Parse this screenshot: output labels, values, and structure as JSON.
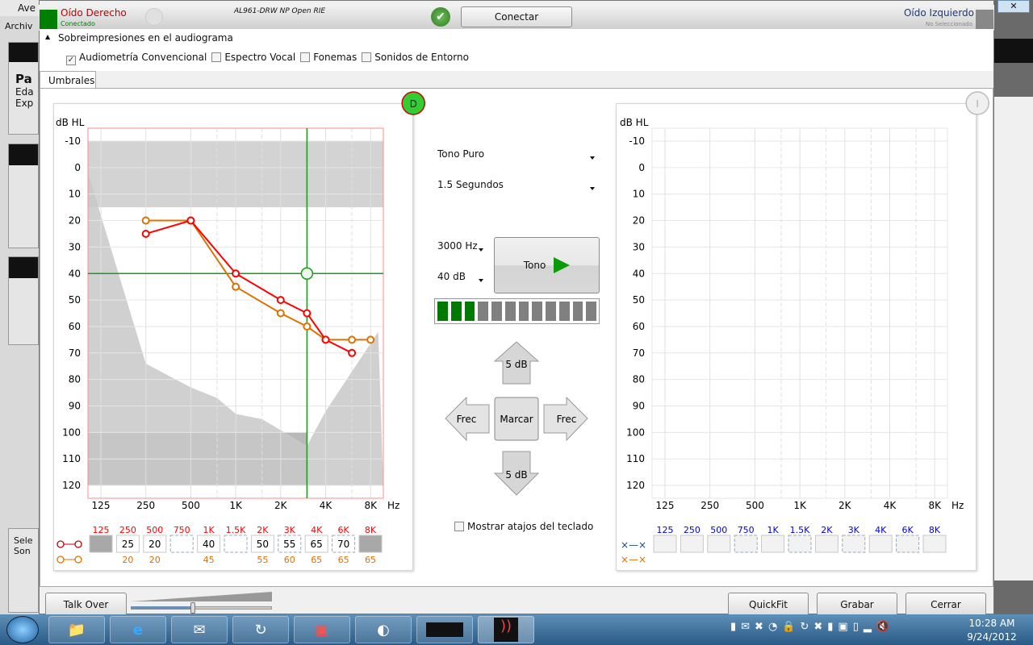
{
  "background_app": {
    "title_fragment": "Ave",
    "menu_fragment": "Archiv",
    "panel_fragment": "Pa",
    "lines": [
      "Eda",
      "Exp"
    ],
    "bottom_fragments": [
      "Sele",
      "Son"
    ]
  },
  "header": {
    "right_ear": {
      "title": "Oído Derecho",
      "status": "Conectado",
      "color": "#008000"
    },
    "device_name": "AL961-DRW NP Open RIE",
    "connect_button": "Conectar",
    "left_ear": {
      "title": "Oído Izquierdo",
      "status": "No Seleccionado"
    }
  },
  "overlays": {
    "title": "Sobreimpresiones en el audiograma",
    "options": [
      {
        "label": "Audiometría Convencional",
        "checked": true
      },
      {
        "label": "Espectro Vocal",
        "checked": false
      },
      {
        "label": "Fonemas",
        "checked": false
      },
      {
        "label": "Sonidos de Entorno",
        "checked": false
      }
    ]
  },
  "tabs": [
    {
      "label": "Umbrales",
      "active": true
    }
  ],
  "controls": {
    "stimulus": "Tono Puro",
    "duration": "1.5 Segundos",
    "frequency": "3000 Hz",
    "level": "40 dB",
    "tone_button": "Tono",
    "level_meter": {
      "lit": 3,
      "total": 12
    },
    "up_button": "5 dB",
    "down_button": "5 dB",
    "left_button": "Frec",
    "right_button": "Frec",
    "mark_button": "Marcar",
    "shortcuts_label": "Mostrar atajos del teclado",
    "shortcuts_checked": false
  },
  "footer": {
    "talk_over": "Talk Over",
    "talk_over_volume": 0.4,
    "quickfit": "QuickFit",
    "save": "Grabar",
    "close": "Cerrar"
  },
  "taskbar": {
    "time": "10:28 AM",
    "date": "9/24/2012"
  },
  "chart_data": [
    {
      "type": "line",
      "ear_badge": "D",
      "ylabel": "dB HL",
      "xlabel": "Hz",
      "ylim": [
        -10,
        120
      ],
      "y_ticks": [
        "-10",
        "0",
        "10",
        "20",
        "30",
        "40",
        "50",
        "60",
        "70",
        "80",
        "90",
        "100",
        "110",
        "120"
      ],
      "x_ticks": [
        "125",
        "250",
        "500",
        "1K",
        "2K",
        "4K",
        "8K"
      ],
      "x_scale": "log",
      "cursor": {
        "frequency_hz": 3000,
        "level_db": 40
      },
      "shading": {
        "normal_band_db": [
          -10,
          15
        ],
        "bottom_band_db": [
          100,
          120
        ],
        "bottom_band_hz": [
          125,
          3000
        ],
        "lower_region": [
          [
            100,
            2
          ],
          [
            250,
            74
          ],
          [
            500,
            83
          ],
          [
            750,
            87
          ],
          [
            1000,
            93
          ],
          [
            1500,
            95
          ],
          [
            3000,
            105
          ],
          [
            4000,
            92
          ],
          [
            9000,
            62
          ]
        ]
      },
      "series": [
        {
          "color": "#ff0000",
          "points": [
            [
              250,
              25
            ],
            [
              500,
              20
            ],
            [
              1000,
              40
            ],
            [
              2000,
              50
            ],
            [
              3000,
              55
            ],
            [
              4000,
              65
            ],
            [
              6000,
              70
            ]
          ]
        },
        {
          "color": "#e07000",
          "points": [
            [
              250,
              20
            ],
            [
              500,
              20
            ],
            [
              1000,
              45
            ],
            [
              2000,
              55
            ],
            [
              3000,
              60
            ],
            [
              4000,
              65
            ],
            [
              6000,
              65
            ],
            [
              8000,
              65
            ]
          ]
        }
      ],
      "table": {
        "label_color": "#ff0000",
        "freqs": [
          "125",
          "250",
          "500",
          "750",
          "1K",
          "1.5K",
          "2K",
          "3K",
          "4K",
          "6K",
          "8K"
        ],
        "values": [
          null,
          "25",
          "20",
          "",
          "40",
          "",
          "50",
          "55",
          "65",
          "70",
          null
        ],
        "secondary": [
          "",
          "20",
          "20",
          "",
          "45",
          "",
          "55",
          "60",
          "65",
          "65",
          "65"
        ]
      }
    },
    {
      "type": "line",
      "ear_badge": "I",
      "ylabel": "dB HL",
      "xlabel": "Hz",
      "ylim": [
        -10,
        120
      ],
      "y_ticks": [
        "-10",
        "0",
        "10",
        "20",
        "30",
        "40",
        "50",
        "60",
        "70",
        "80",
        "90",
        "100",
        "110",
        "120"
      ],
      "x_ticks": [
        "125",
        "250",
        "500",
        "1K",
        "2K",
        "4K",
        "8K"
      ],
      "x_scale": "log",
      "series": [],
      "table": {
        "label_color": "#0000ee",
        "freqs": [
          "125",
          "250",
          "500",
          "750",
          "1K",
          "1.5K",
          "2K",
          "3K",
          "4K",
          "6K",
          "8K"
        ],
        "values": [
          "",
          "",
          "",
          "",
          "",
          "",
          "",
          "",
          "",
          "",
          ""
        ],
        "secondary": [
          "",
          "",
          "",
          "",
          "",
          "",
          "",
          "",
          "",
          "",
          ""
        ]
      }
    }
  ]
}
